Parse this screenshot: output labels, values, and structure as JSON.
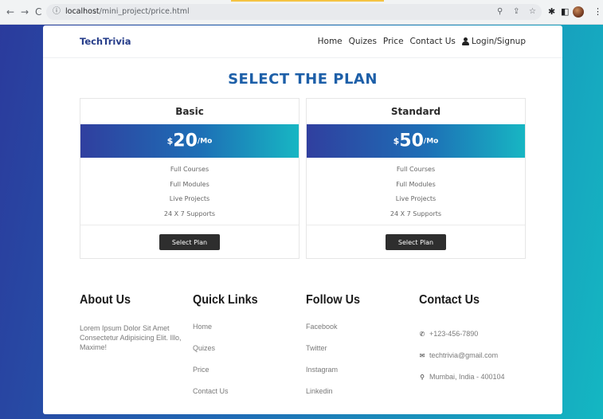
{
  "browser": {
    "back": "←",
    "forward": "→",
    "reload": "C",
    "url_host": "localhost",
    "url_path": "/mini_project/price.html"
  },
  "navbar": {
    "brand": "TechTrivia",
    "links": [
      "Home",
      "Quizes",
      "Price",
      "Contact Us"
    ],
    "login": "Login/Signup"
  },
  "heading": "SELECT THE PLAN",
  "plans": [
    {
      "name": "Basic",
      "currency": "$",
      "amount": "20",
      "period": "/Mo",
      "features": [
        "Full Courses",
        "Full Modules",
        "Live Projects",
        "24 X 7 Supports"
      ],
      "button": "Select Plan"
    },
    {
      "name": "Standard",
      "currency": "$",
      "amount": "50",
      "period": "/Mo",
      "features": [
        "Full Courses",
        "Full Modules",
        "Live Projects",
        "24 X 7 Supports"
      ],
      "button": "Select Plan"
    }
  ],
  "footer": {
    "about": {
      "title": "About Us",
      "text": "Lorem Ipsum Dolor Sit Amet Consectetur Adipisicing Elit. Illo, Maxime!"
    },
    "quick_links": {
      "title": "Quick Links",
      "items": [
        "Home",
        "Quizes",
        "Price",
        "Contact Us"
      ]
    },
    "follow": {
      "title": "Follow Us",
      "items": [
        "Facebook",
        "Twitter",
        "Instagram",
        "Linkedin"
      ]
    },
    "contact": {
      "title": "Contact Us",
      "phone": "+123-456-7890",
      "email": "techtrivia@gmail.com",
      "address": "Mumbai, India - 400104"
    }
  },
  "colors": {
    "brand": "#263d8a",
    "heading": "#1d5fa8",
    "gradient_start": "#303f9f",
    "gradient_end": "#17b6c3"
  },
  "icons": [
    "info-icon",
    "zoom-icon",
    "share-icon",
    "star-icon",
    "puzzle-icon",
    "sidepanel-icon",
    "user-icon",
    "phone-icon",
    "mail-icon",
    "location-icon"
  ]
}
